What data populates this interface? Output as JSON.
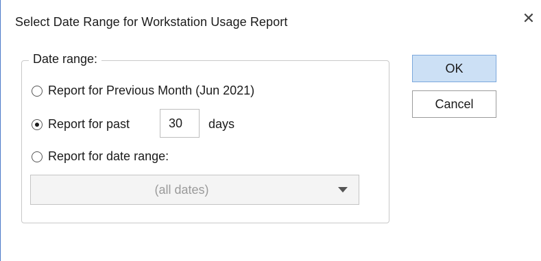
{
  "window": {
    "title": "Select Date Range for Workstation Usage Report",
    "close_glyph": "✕"
  },
  "date_range_group": {
    "legend": "Date range:",
    "options": [
      {
        "label": "Report for Previous Month (Jun 2021)",
        "selected": false
      },
      {
        "label": "Report for past",
        "selected": true
      },
      {
        "label": "Report for date range:",
        "selected": false
      }
    ],
    "days_value": "30",
    "days_suffix": "days",
    "date_range_select": {
      "selected": "(all dates)",
      "enabled": false
    }
  },
  "buttons": {
    "ok_label": "OK",
    "cancel_label": "Cancel"
  },
  "colors": {
    "accent": "#4a78c8",
    "ok_button_bg": "#cce0f5",
    "ok_button_border": "#7aa7dc"
  },
  "icons": {
    "close": "close-icon",
    "dropdown": "chevron-down-icon"
  }
}
